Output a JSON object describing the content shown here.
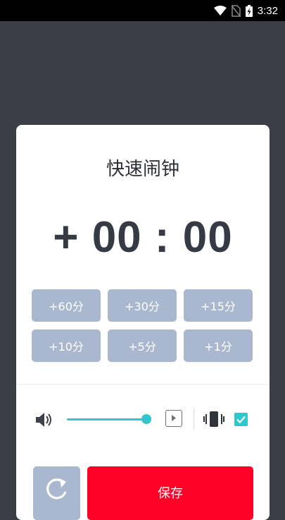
{
  "status_bar": {
    "time": "3:32",
    "icons": [
      "wifi-icon",
      "no-sim-icon",
      "battery-charging-icon"
    ]
  },
  "dialog": {
    "title": "快速闹钟",
    "time_display": "+ 00 : 00",
    "quick_buttons": [
      "+60分",
      "+30分",
      "+15分",
      "+10分",
      "+5分",
      "+1分"
    ],
    "volume_level": 1.0,
    "vibrate_checked": true,
    "save_label": "保存"
  },
  "colors": {
    "background": "#3b3e47",
    "accent_teal": "#2ec8cc",
    "button_gray_blue": "#a9b8cf",
    "save_red": "#ff0026"
  }
}
